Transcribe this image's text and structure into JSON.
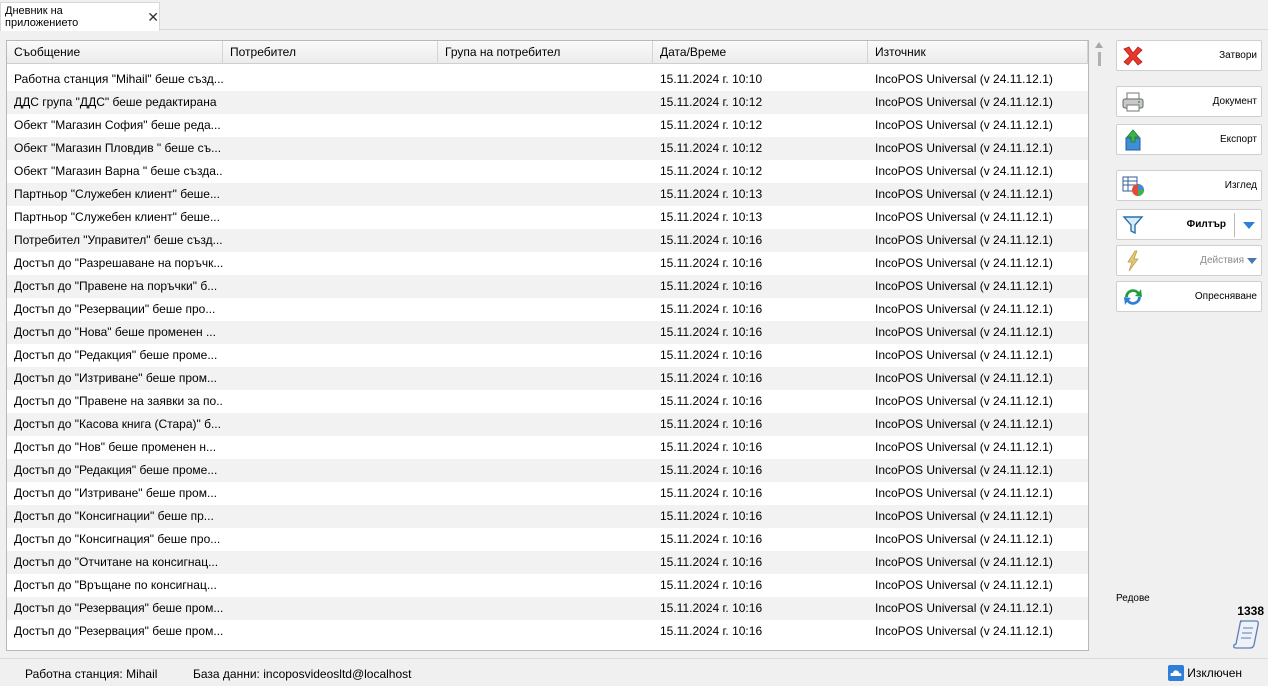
{
  "tab": {
    "title": "Дневник на приложението",
    "close": "✕"
  },
  "grid": {
    "columns": [
      "Съобщение",
      "Потребител",
      "Група на потребител",
      "Дата/Време",
      "Източник"
    ],
    "rows": [
      [
        "Работна станция \"Mihail\" беше създ...",
        "",
        "",
        "15.11.2024 г. 10:10",
        "IncoPOS Universal (v 24.11.12.1)"
      ],
      [
        "ДДС група \"ДДС\" беше редактирана",
        "",
        "",
        "15.11.2024 г. 10:12",
        "IncoPOS Universal (v 24.11.12.1)"
      ],
      [
        "Обект \"Магазин София\" беше реда...",
        "",
        "",
        "15.11.2024 г. 10:12",
        "IncoPOS Universal (v 24.11.12.1)"
      ],
      [
        "Обект \"Магазин Пловдив \" беше съ...",
        "",
        "",
        "15.11.2024 г. 10:12",
        "IncoPOS Universal (v 24.11.12.1)"
      ],
      [
        "Обект \"Магазин Варна \" беше създа...",
        "",
        "",
        "15.11.2024 г. 10:12",
        "IncoPOS Universal (v 24.11.12.1)"
      ],
      [
        "Партньор \"Служебен клиент\" беше...",
        "",
        "",
        "15.11.2024 г. 10:13",
        "IncoPOS Universal (v 24.11.12.1)"
      ],
      [
        "Партньор \"Служебен клиент\" беше...",
        "",
        "",
        "15.11.2024 г. 10:13",
        "IncoPOS Universal (v 24.11.12.1)"
      ],
      [
        "Потребител \"Управител\" беше създ...",
        "",
        "",
        "15.11.2024 г. 10:16",
        "IncoPOS Universal (v 24.11.12.1)"
      ],
      [
        "Достъп до \"Разрешаване на поръчк...",
        "",
        "",
        "15.11.2024 г. 10:16",
        "IncoPOS Universal (v 24.11.12.1)"
      ],
      [
        "Достъп до \"Правене на поръчки\" б...",
        "",
        "",
        "15.11.2024 г. 10:16",
        "IncoPOS Universal (v 24.11.12.1)"
      ],
      [
        "Достъп до \"Резервации\" беше про...",
        "",
        "",
        "15.11.2024 г. 10:16",
        "IncoPOS Universal (v 24.11.12.1)"
      ],
      [
        "Достъп до \"Нова\" беше променен ...",
        "",
        "",
        "15.11.2024 г. 10:16",
        "IncoPOS Universal (v 24.11.12.1)"
      ],
      [
        "Достъп до \"Редакция\" беше проме...",
        "",
        "",
        "15.11.2024 г. 10:16",
        "IncoPOS Universal (v 24.11.12.1)"
      ],
      [
        "Достъп до \"Изтриване\" беше пром...",
        "",
        "",
        "15.11.2024 г. 10:16",
        "IncoPOS Universal (v 24.11.12.1)"
      ],
      [
        "Достъп до \"Правене на заявки за по...",
        "",
        "",
        "15.11.2024 г. 10:16",
        "IncoPOS Universal (v 24.11.12.1)"
      ],
      [
        "Достъп до \"Касова книга (Стара)\" б...",
        "",
        "",
        "15.11.2024 г. 10:16",
        "IncoPOS Universal (v 24.11.12.1)"
      ],
      [
        "Достъп до \"Нов\" беше променен н...",
        "",
        "",
        "15.11.2024 г. 10:16",
        "IncoPOS Universal (v 24.11.12.1)"
      ],
      [
        "Достъп до \"Редакция\" беше проме...",
        "",
        "",
        "15.11.2024 г. 10:16",
        "IncoPOS Universal (v 24.11.12.1)"
      ],
      [
        "Достъп до \"Изтриване\" беше пром...",
        "",
        "",
        "15.11.2024 г. 10:16",
        "IncoPOS Universal (v 24.11.12.1)"
      ],
      [
        "Достъп до \"Консигнации\" беше пр...",
        "",
        "",
        "15.11.2024 г. 10:16",
        "IncoPOS Universal (v 24.11.12.1)"
      ],
      [
        "Достъп до \"Консигнация\" беше про...",
        "",
        "",
        "15.11.2024 г. 10:16",
        "IncoPOS Universal (v 24.11.12.1)"
      ],
      [
        "Достъп до \"Отчитане на консигнац...",
        "",
        "",
        "15.11.2024 г. 10:16",
        "IncoPOS Universal (v 24.11.12.1)"
      ],
      [
        "Достъп до \"Връщане по консигнац...",
        "",
        "",
        "15.11.2024 г. 10:16",
        "IncoPOS Universal (v 24.11.12.1)"
      ],
      [
        "Достъп до \"Резервация\" беше пром...",
        "",
        "",
        "15.11.2024 г. 10:16",
        "IncoPOS Universal (v 24.11.12.1)"
      ],
      [
        "Достъп до \"Резервация\" беше пром...",
        "",
        "",
        "15.11.2024 г. 10:16",
        "IncoPOS Universal (v 24.11.12.1)"
      ]
    ]
  },
  "sidebar": {
    "close": "Затвори",
    "document": "Документ",
    "export": "Експорт",
    "view": "Изглед",
    "filter": "Филтър",
    "actions": "Действия",
    "refresh": "Опресняване",
    "rows_label": "Редове",
    "rows_count": "1338"
  },
  "status": {
    "workstation": "Работна станция: Mihail",
    "database": "База данни: incoposvideosltd@localhost",
    "logout": "Изключен"
  },
  "icons": {
    "close": "close-x-icon",
    "document": "printer-icon",
    "export": "export-box-icon",
    "view": "table-chart-icon",
    "filter": "funnel-icon",
    "actions": "lightning-icon",
    "refresh": "refresh-arrows-icon",
    "rows": "scroll-icon",
    "logout": "cloud-icon"
  },
  "colors": {
    "close_red": "#e8372b",
    "accent_blue": "#2f7ed8",
    "refresh_green": "#1e9e3a"
  }
}
